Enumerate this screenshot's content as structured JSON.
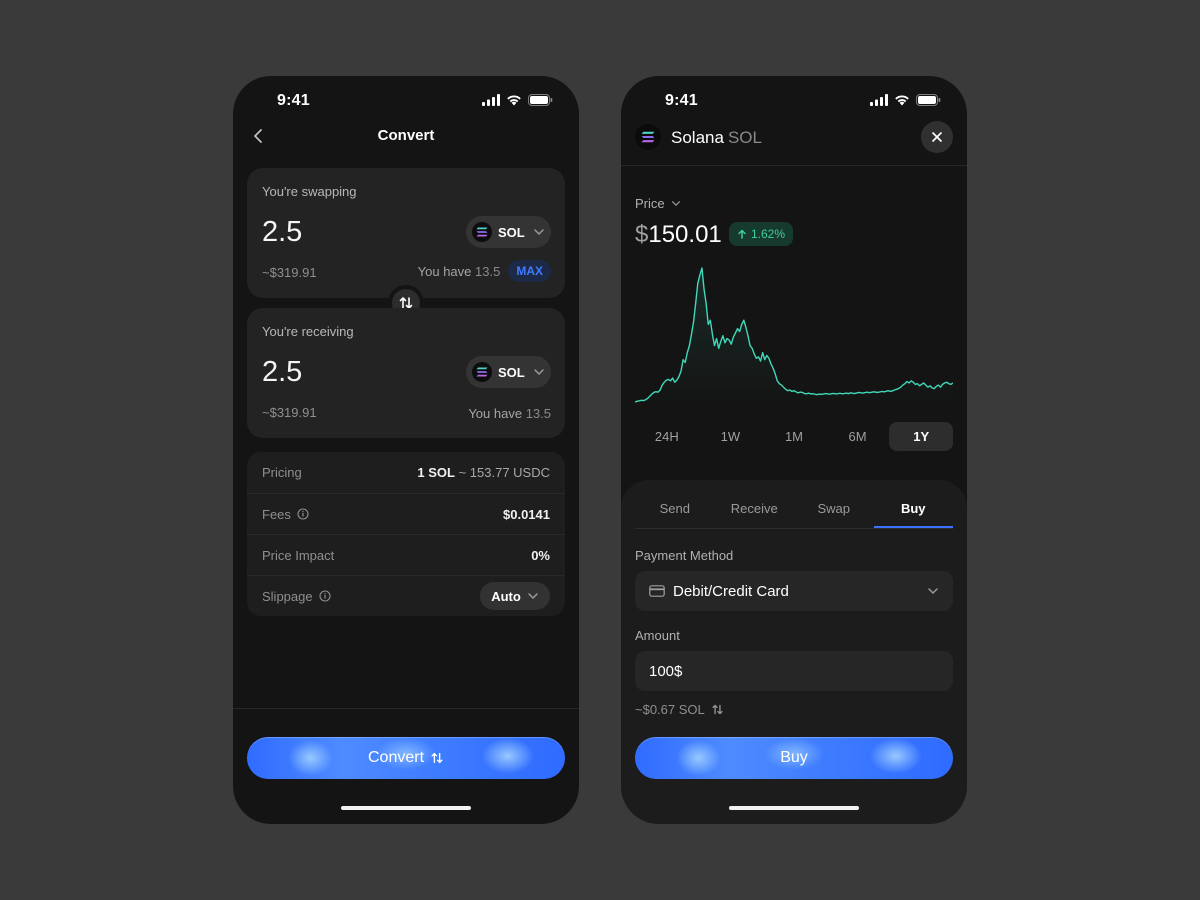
{
  "left_phone": {
    "status": {
      "time": "9:41"
    },
    "header": {
      "title": "Convert"
    },
    "swapping": {
      "label": "You're swapping",
      "amount": "2.5",
      "token": "SOL",
      "usd_value": "~$319.91",
      "balance_label": "You have",
      "balance_value": "13.5",
      "max_label": "MAX"
    },
    "receiving": {
      "label": "You're receiving",
      "amount": "2.5",
      "token": "SOL",
      "usd_value": "~$319.91",
      "balance_label": "You have",
      "balance_value": "13.5"
    },
    "details": {
      "pricing_label": "Pricing",
      "pricing_value": "1 SOL",
      "pricing_muted": " ~ 153.77 USDC",
      "fees_label": "Fees",
      "fees_value": "$0.0141",
      "impact_label": "Price Impact",
      "impact_value": "0%",
      "slippage_label": "Slippage",
      "slippage_value": "Auto"
    },
    "convert_button": "Convert"
  },
  "right_phone": {
    "status": {
      "time": "9:41"
    },
    "coin": {
      "name": "Solana",
      "symbol": "SOL"
    },
    "price": {
      "label": "Price",
      "value": "150.01",
      "currency_symbol": "$",
      "change": "1.62%"
    },
    "chart_data": {
      "type": "line",
      "series": [
        {
          "values": [
            0.0,
            0.5,
            0.8,
            1.2,
            1.0,
            1.5,
            2.5,
            4.0,
            5.5,
            6.8,
            7.3,
            7.0,
            8.5,
            12.0,
            14.0,
            15.5,
            16.0,
            15.0,
            17.0,
            14.0,
            15.5,
            18.0,
            22.0,
            30.0,
            28.0,
            35.0,
            40.0,
            48.0,
            57.0,
            70.0,
            84.0,
            90.0,
            95.0,
            80.0,
            70.0,
            55.0,
            58.0,
            48.0,
            40.0,
            45.0,
            38.0,
            43.0,
            47.0,
            42.0,
            45.0,
            44.0,
            41.0,
            46.0,
            49.0,
            52.0,
            50.0,
            55.0,
            58.0,
            53.0,
            47.0,
            40.0,
            38.0,
            34.0,
            31.0,
            32.0,
            29.0,
            35.0,
            30.0,
            33.0,
            31.0,
            27.0,
            24.0,
            20.0,
            15.0,
            13.0,
            12.0,
            10.5,
            9.0,
            8.0,
            8.5,
            7.5,
            8.0,
            7.2,
            6.5,
            7.0,
            6.8,
            6.0,
            5.8,
            6.3,
            5.7,
            5.9,
            5.5,
            5.2,
            5.6,
            5.4,
            5.6,
            6.0,
            5.8,
            5.5,
            5.9,
            6.1,
            5.7,
            5.9,
            6.2,
            5.8,
            6.0,
            6.3,
            5.9,
            6.5,
            6.2,
            6.0,
            6.4,
            6.8,
            6.5,
            6.3,
            6.7,
            7.0,
            6.6,
            6.9,
            7.2,
            7.0,
            6.8,
            7.1,
            7.5,
            7.2,
            7.6,
            8.0,
            7.6,
            7.8,
            8.5,
            9.0,
            9.5,
            10.5,
            12.0,
            13.0,
            14.5,
            13.5,
            15.0,
            14.0,
            12.5,
            13.0,
            11.5,
            12.5,
            13.5,
            12.0,
            10.5,
            11.5,
            10.0,
            9.5,
            11.0,
            12.0,
            10.5,
            12.5,
            13.5,
            14.0,
            13.0,
            12.5,
            13.5
          ]
        }
      ]
    },
    "timeframes": [
      "24H",
      "1W",
      "1M",
      "6M",
      "1Y"
    ],
    "active_timeframe": "1Y",
    "tabs": [
      "Send",
      "Receive",
      "Swap",
      "Buy"
    ],
    "active_tab": "Buy",
    "payment": {
      "label": "Payment Method",
      "value": "Debit/Credit Card"
    },
    "amount": {
      "label": "Amount",
      "value": "100$"
    },
    "conversion": "~$0.67 SOL",
    "buy_button": "Buy"
  },
  "colors": {
    "accent": "#3b73ff",
    "positive": "#3ccf9b",
    "chart_line": "#3fd8b8"
  },
  "icons": [
    "signal-icon",
    "wifi-icon",
    "battery-icon",
    "back-icon",
    "solana-icon",
    "chevron-down-icon",
    "swap-arrows-icon",
    "info-icon",
    "close-icon",
    "arrow-up-icon",
    "card-icon"
  ]
}
